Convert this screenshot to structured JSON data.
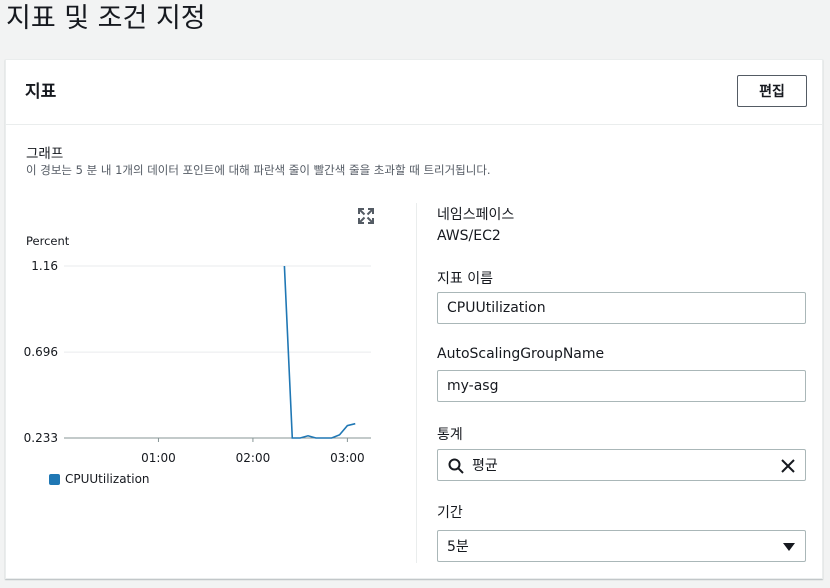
{
  "page": {
    "title": "지표 및 조건 지정"
  },
  "panel": {
    "title": "지표",
    "edit_label": "편집",
    "graph_label": "그래프",
    "graph_description": "이 경보는 5 분 내 1개의 데이터 포인트에 대해 파란색 줄이 빨간색 줄을 초과할 때 트리거됩니다."
  },
  "chart_data": {
    "type": "line",
    "ylabel": "Percent",
    "y_ticks": [
      "1.16",
      "0.696",
      "0.233"
    ],
    "x_ticks": [
      "01:00",
      "02:00",
      "03:00"
    ],
    "ylim": [
      0.233,
      1.16
    ],
    "x": [
      "00:00",
      "00:30",
      "01:00",
      "01:30",
      "02:00",
      "02:20",
      "02:25",
      "02:35",
      "02:40",
      "02:45",
      "02:50",
      "02:55",
      "03:00",
      "03:05",
      "03:10"
    ],
    "series": [
      {
        "name": "CPUUtilization",
        "color": "#1f77b4",
        "points": [
          [
            "02:20",
            1.16
          ],
          [
            "02:25",
            0.233
          ],
          [
            "02:30",
            0.233
          ],
          [
            "02:35",
            0.245
          ],
          [
            "02:40",
            0.233
          ],
          [
            "02:45",
            0.233
          ],
          [
            "02:50",
            0.233
          ],
          [
            "02:55",
            0.25
          ],
          [
            "03:00",
            0.3
          ],
          [
            "03:05",
            0.31
          ]
        ]
      }
    ],
    "grid": true,
    "legend": "bottom"
  },
  "details": {
    "namespace_label": "네임스페이스",
    "namespace_value": "AWS/EC2",
    "metric_name_label": "지표 이름",
    "metric_name_value": "CPUUtilization",
    "dimension_label": "AutoScalingGroupName",
    "dimension_value": "my-asg",
    "statistic_label": "통계",
    "statistic_value": "평균",
    "period_label": "기간",
    "period_value": "5분"
  },
  "icons": {
    "expand": "expand-icon",
    "search": "search-icon",
    "clear": "close-icon",
    "caret": "caret-down-icon"
  }
}
